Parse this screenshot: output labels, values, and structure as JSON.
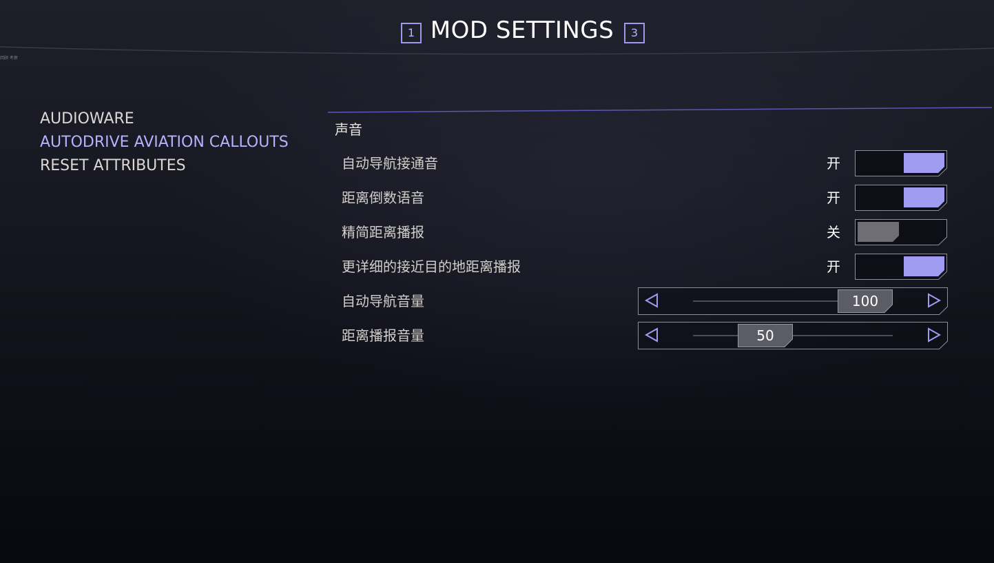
{
  "header": {
    "title": "MOD SETTINGS",
    "prev_key": "1",
    "next_key": "3",
    "corner_tag": "回顾 考察"
  },
  "nav": {
    "items": [
      {
        "label": "AUDIOWARE",
        "active": false
      },
      {
        "label": "AUTODRIVE AVIATION CALLOUTS",
        "active": true
      },
      {
        "label": "RESET ATTRIBUTES",
        "active": false
      }
    ]
  },
  "panel": {
    "section_title": "声音",
    "settings": [
      {
        "label": "自动导航接通音",
        "type": "toggle",
        "state_label": "开",
        "on": true
      },
      {
        "label": "距离倒数语音",
        "type": "toggle",
        "state_label": "开",
        "on": true
      },
      {
        "label": "精简距离播报",
        "type": "toggle",
        "state_label": "关",
        "on": false
      },
      {
        "label": "更详细的接近目的地距离播报",
        "type": "toggle",
        "state_label": "开",
        "on": true
      },
      {
        "label": "自动导航音量",
        "type": "slider",
        "value": "100",
        "min": 0,
        "max": 100
      },
      {
        "label": "距离播报音量",
        "type": "slider",
        "value": "50",
        "min": 0,
        "max": 100
      }
    ]
  },
  "colors": {
    "accent": "#a09cf2",
    "toggle_on": "#a09cf2",
    "toggle_off": "#6e6e74",
    "thumb": "#5c5c66",
    "border": "#8f8d98"
  },
  "icons": {
    "slider_left": "triangle-left-icon",
    "slider_right": "triangle-right-icon"
  }
}
